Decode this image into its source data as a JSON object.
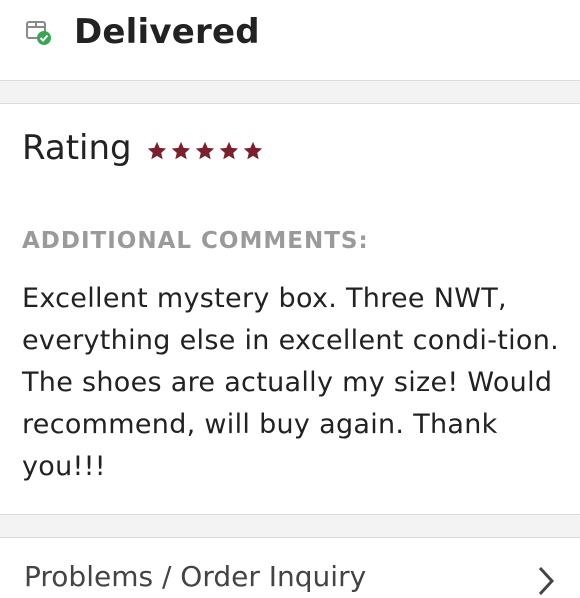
{
  "status": {
    "label": "Delivered",
    "icon": "delivered-box-icon",
    "check_color": "#3aa655"
  },
  "rating": {
    "title": "Rating",
    "stars": 5,
    "max_stars": 5,
    "star_color": "#7a1f2b"
  },
  "comments": {
    "label": "ADDITIONAL COMMENTS:",
    "text": "Excellent mystery box. Three NWT, everything else in excellent condi-tion. The shoes are actually my size! Would recommend, will buy again. Thank you!!!"
  },
  "problems": {
    "label": "Problems / Order Inquiry",
    "icon": "chevron-right-icon"
  }
}
